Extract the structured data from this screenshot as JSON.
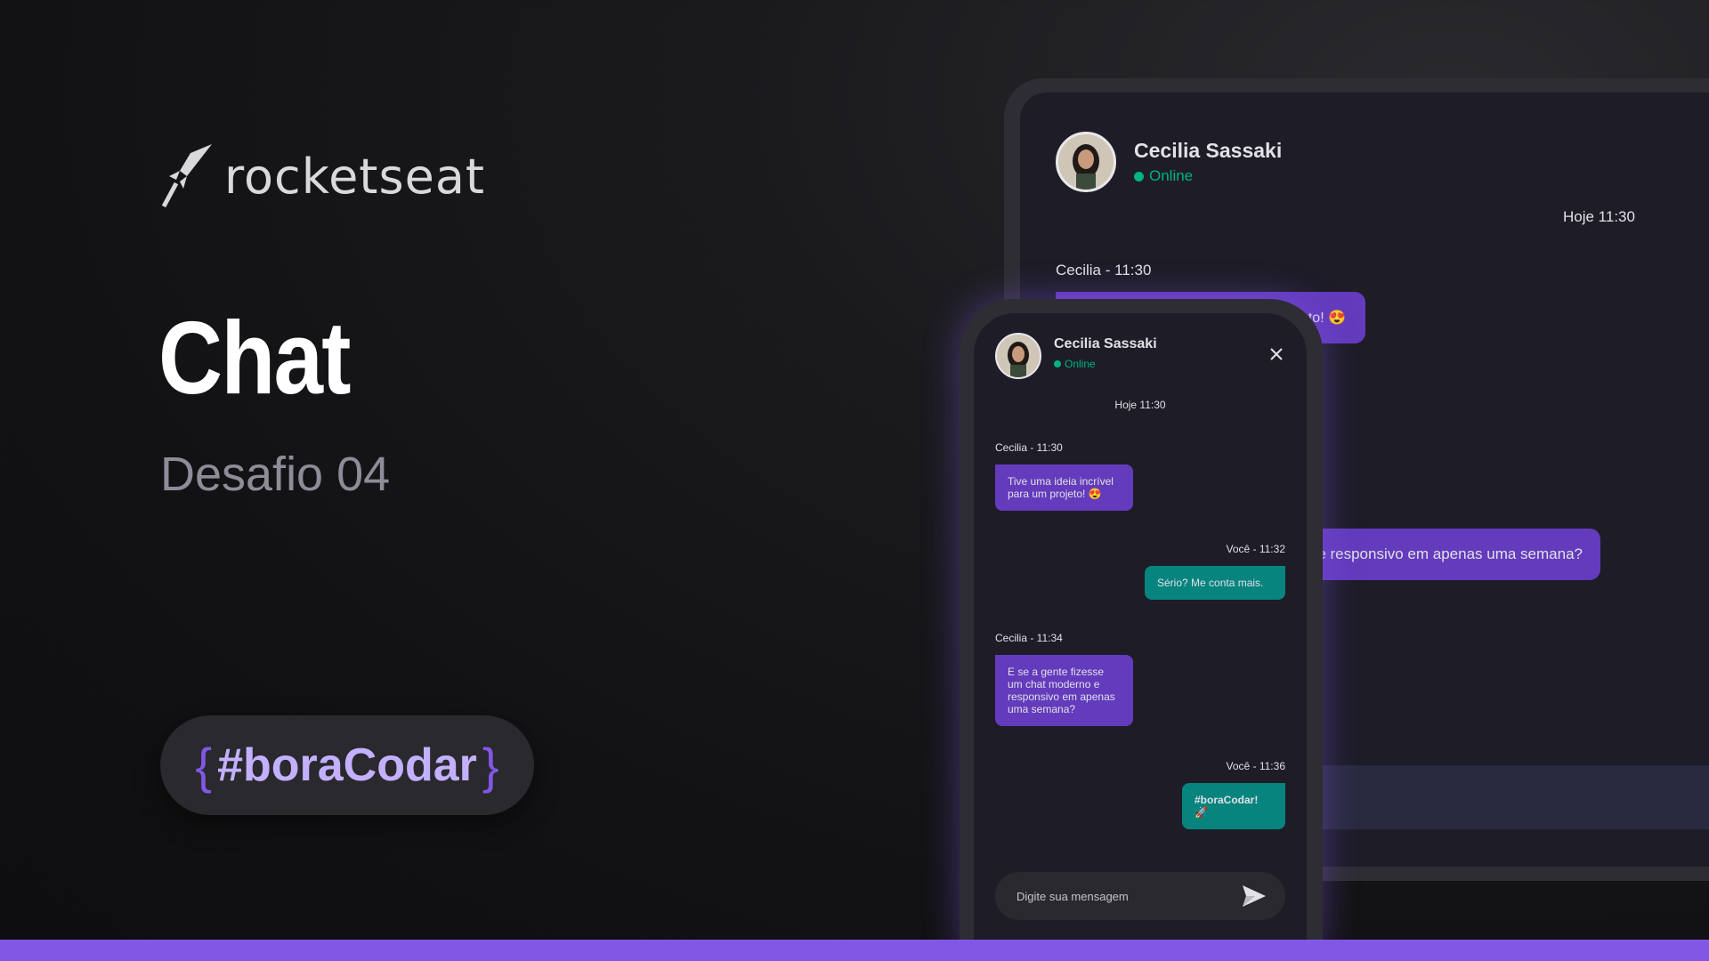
{
  "brand": {
    "name": "rocketseat"
  },
  "hero": {
    "title": "Chat",
    "subtitle": "Desafio 04",
    "hashtag": "#boraCodar",
    "brace_open": "{",
    "brace_close": "}"
  },
  "colors": {
    "accent": "#8257e5",
    "incoming_bubble": "#633bbc",
    "outgoing_bubble": "#07847e",
    "online": "#00b37e"
  },
  "desktop": {
    "contact_name": "Cecilia Sassaki",
    "status": "Online",
    "date_divider": "Hoje 11:30",
    "sender_label": "Cecilia - 11:30",
    "bubble1_text": "to! 😍",
    "bubble2_text": "e responsivo em apenas uma semana?"
  },
  "phone": {
    "contact_name": "Cecilia Sassaki",
    "status": "Online",
    "date_divider": "Hoje 11:30",
    "close_icon": "close-icon",
    "messages": [
      {
        "label": "Cecilia - 11:30",
        "text": "Tive uma ideia incrível para um projeto! 😍",
        "direction": "in"
      },
      {
        "label": "Você - 11:32",
        "text": "Sério? Me conta mais.",
        "direction": "out"
      },
      {
        "label": "Cecilia - 11:34",
        "text": "E se a gente fizesse um chat moderno e responsivo em apenas uma semana?",
        "direction": "in"
      },
      {
        "label": "Você - 11:36",
        "text": "#boraCodar! 🚀",
        "direction": "out"
      }
    ],
    "input_placeholder": "Digite sua mensagem",
    "send_icon": "send-icon"
  }
}
